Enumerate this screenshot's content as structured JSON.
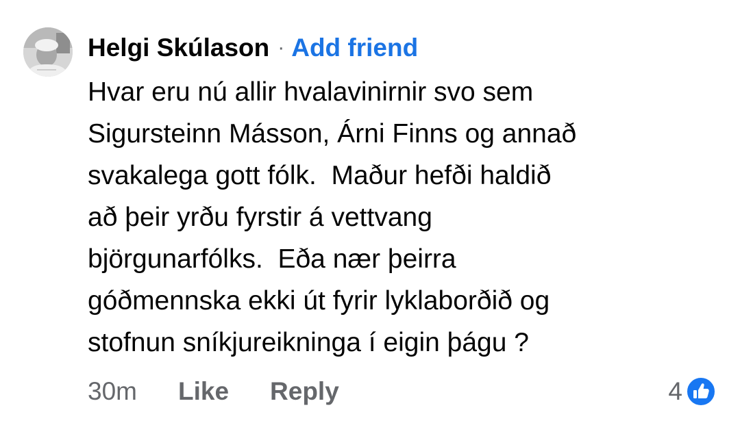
{
  "comment": {
    "author": "Helgi Skúlason",
    "separator": "·",
    "add_friend_label": "Add friend",
    "text_lines": [
      "Hvar eru nú allir hvalavinirnir svo sem",
      "Sigursteinn Másson, Árni Finns og annað",
      "svakalega gott fólk.  Maður hefði haldið",
      "að þeir yrðu fyrstir á vettvang",
      "björgunarfólks.  Eða nær þeirra",
      "góðmennska ekki út fyrir lyklaborðið og",
      "stofnun sníkjureikninga í eigin þágu ?"
    ],
    "timestamp": "30m",
    "like_label": "Like",
    "reply_label": "Reply",
    "reaction_count": "4",
    "reaction_icon": "like-reaction-icon",
    "colors": {
      "text": "#050505",
      "secondary": "#65676b",
      "link": "#1b74e4",
      "reaction": "#1877f2"
    }
  }
}
